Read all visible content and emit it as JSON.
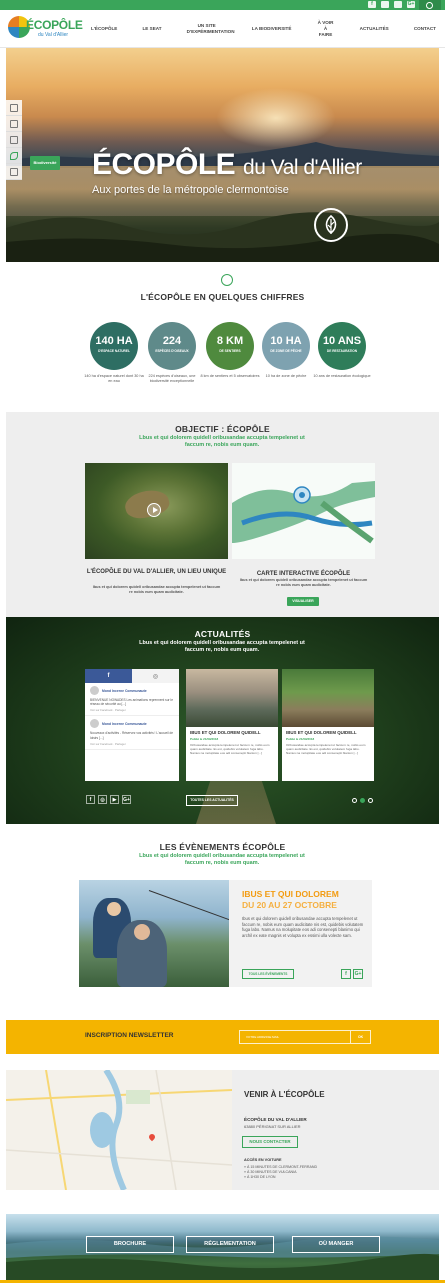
{
  "topbar": {
    "social": [
      "f",
      "ig",
      "yt",
      "G+"
    ]
  },
  "header": {
    "logo_name": "ÉCOPÔLE",
    "logo_sub": "du Val d'Allier",
    "nav": [
      "L'ÉCOPÔLE",
      "LE SEAT",
      "UN SITE D'EXPÉRIMENTATION",
      "LA BIODIVERSITÉ",
      "À VOIR À FAIRE",
      "ACTUALITÉS",
      "CONTACT"
    ]
  },
  "hero": {
    "title": "ÉCOPÔLE",
    "title_suffix": "du Val d'Allier",
    "subtitle": "Aux portes de la métropole clermontoise",
    "button": "Biodiversité"
  },
  "chiffres": {
    "title": "L'ÉCOPÔLE EN QUELQUES CHIFFRES",
    "items": [
      {
        "big": "140 HA",
        "small": "D'ESPACE NATUREL",
        "caption": "140 ha d'espace naturel dont 30 ha en eau",
        "color": "#2e6e63"
      },
      {
        "big": "224",
        "small": "ESPÈCES D'OISEAUX",
        "caption": "224 espèces d'oiseaux, une biodiversité exceptionnelle",
        "color": "#5f8a8a"
      },
      {
        "big": "8 KM",
        "small": "DE SENTIERS",
        "caption": "8 km de sentiers et 5 observatoires",
        "color": "#4f8a3e"
      },
      {
        "big": "10 HA",
        "small": "DE ZONE DE PÊCHE",
        "caption": "10 ha de zone de pêche",
        "color": "#7ea2b0"
      },
      {
        "big": "10 ANS",
        "small": "DE RESTAURATION",
        "caption": "10 ans de restauration écologique",
        "color": "#2f7d5a"
      }
    ]
  },
  "objectif": {
    "title": "OBJECTIF : ÉCOPÔLE",
    "subtitle": "Lbus et qui dolorem quidell oribusandae accupta tempelenet ut faccum re, nobis eum quam.",
    "card1_title": "L'ÉCOPÔLE DU VAL D'ALLIER, UN LIEU UNIQUE",
    "card1_text": "Ibus et qui dolorem quidell oribusandae accupta tempelenet ut faccum re nobis eum quam audicitate.",
    "card2_title": "CARTE INTERACTIVE ÉCOPÔLE",
    "card2_text": "Ibus et qui dolorem quidell oribusandae accupta tempelenet ut faccum re nobis eum quam audicitate.",
    "card2_button": "VISUALISER"
  },
  "actualites": {
    "title": "ACTUALITÉS",
    "subtitle": "Lbus et qui dolorem quidell oribusandae accupta tempelenet ut faccum re, nobis eum quam.",
    "posts": [
      {
        "name": "Mond Incerne Communaute",
        "txt": "BIENVENUE NOWADES Les animations reprennent sur le réseau de sécurité au [...]",
        "meta": "Voir sur Facebook · Partager"
      },
      {
        "name": "Mond Incerne Communaute",
        "txt": "Nouveaux d'activités - Réservez vos activités ! L'accueil de loisirs [...]",
        "meta": "Voir sur Facebook · Partager"
      }
    ],
    "cards": [
      {
        "title": "IBUS ET QUI DOLOREM QUIDELL",
        "date": "Publié le 21/09/2018",
        "text": "Oribusandae accupta tempelenet ut faccum re, nobis eum quam audicitate nis est, quidebis volutatem fuga labo. Namus na molupitate eos adi consenepti blanion [...]"
      },
      {
        "title": "IBUS ET QUI DOLOREM QUIDELL",
        "date": "Publié le 21/09/2018",
        "text": "Oribusandae accupta tempelenet ut faccum re, nobis eum quam audicitate nis est, quidebis volutatem fuga labo. Namus na molupitate eos adi consenepti blanion [...]"
      }
    ],
    "all_button": "TOUTES LES ACTUALITÉS",
    "social": [
      "f",
      "ig",
      "yt",
      "G+"
    ]
  },
  "evenements": {
    "title": "LES ÉVÈNEMENTS ÉCOPÔLE",
    "subtitle": "Lbus et qui dolorem quidell oribusandae accupta tempelenet ut faccum re, nobis eum quam.",
    "event_title": "IBUS ET QUI DOLOREM",
    "event_date": "DU 20 AU 27 OCTOBRE",
    "event_text": "Ibus et qui dolorem quidell oribusandae accupta tempelenet ut faccum re, nobis eum quam audicitate nis est, quidebis volutatem fuga labo. Namus na molupitate eos adi consenepti blanimo qui archil ex eate magnis et volupta ex essimi ulla volecte sam.",
    "all_button": "TOUS LES ÉVÈNEMENTS",
    "share": [
      "f",
      "G+"
    ]
  },
  "newsletter": {
    "label": "INSCRIPTION NEWSLETTER",
    "placeholder": "VOTRE ADRESSE MAIL",
    "button": "OK"
  },
  "venir": {
    "title": "VENIR À L'ÉCOPÔLE",
    "name": "ÉCOPÔLE DU VAL D'ALLIER",
    "address": "63880 PÉRIGNAT SUR ALLIER",
    "contact_button": "NOUS CONTACTER",
    "acces": "ACCÈS EN VOITURE",
    "list": [
      "» À 15 MINUTES DE CLERMONT-FERRAND",
      "» À 30 MINUTES DE VULCANIA",
      "» À 1H30 DE LYON"
    ]
  },
  "footer": {
    "buttons": [
      "BROCHURE",
      "RÉGLEMENTATION",
      "OÙ MANGER"
    ]
  }
}
